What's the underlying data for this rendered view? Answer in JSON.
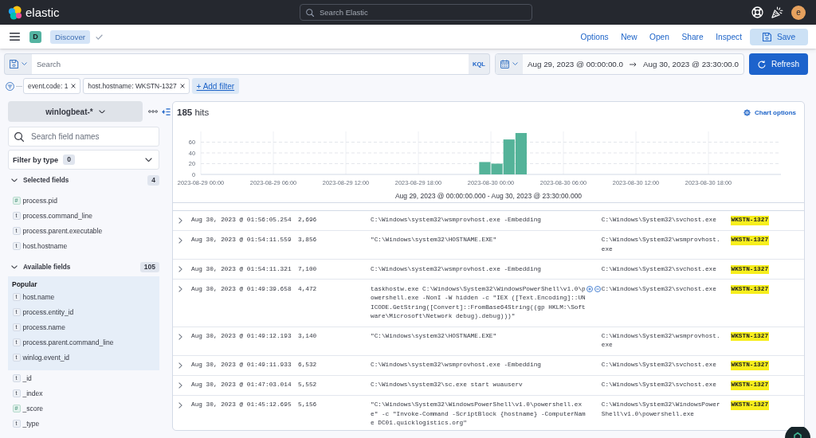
{
  "top_bar": {
    "brand": "elastic",
    "search": {
      "placeholder": "Search Elastic"
    },
    "user_initial": "e"
  },
  "header": {
    "space_initial": "D",
    "breadcrumb": "Discover",
    "links": [
      "Options",
      "New",
      "Open",
      "Share",
      "Inspect"
    ],
    "save_button": "Save"
  },
  "query_bar": {
    "search": {
      "placeholder": "Search"
    },
    "language": "KQL",
    "start_date": "Aug 29, 2023 @ 00:00:00.0",
    "end_date": "Aug 30, 2023 @ 23:30:00.0",
    "refresh_button": "Refresh"
  },
  "filter_bar": {
    "filters": [
      "event.code: 1",
      "host.hostname: WKSTN-1327"
    ],
    "add_filter": "+ Add filter"
  },
  "sidebar": {
    "index_pattern": "winlogbeat-*",
    "field_search": {
      "placeholder": "Search field names"
    },
    "filter_by_type": {
      "label": "Filter by type",
      "count": "0"
    },
    "sections": [
      {
        "title": "Selected fields",
        "count": "4",
        "expanded": true,
        "groups": [
          {
            "fields": [
              {
                "name": "process.pid",
                "kind": "number",
                "token": "#"
              },
              {
                "name": "process.command_line",
                "kind": "string",
                "token": "t"
              },
              {
                "name": "process.parent.executable",
                "kind": "string",
                "token": "t"
              },
              {
                "name": "host.hostname",
                "kind": "string",
                "token": "t"
              }
            ]
          }
        ]
      },
      {
        "title": "Available fields",
        "count": "105",
        "expanded": true,
        "groups": [
          {
            "title": "Popular",
            "fields": [
              {
                "name": "host.name",
                "kind": "string",
                "token": "t"
              },
              {
                "name": "process.entity_id",
                "kind": "string",
                "token": "t"
              },
              {
                "name": "process.name",
                "kind": "string",
                "token": "t"
              },
              {
                "name": "process.parent.command_line",
                "kind": "string",
                "token": "t"
              },
              {
                "name": "winlog.event_id",
                "kind": "string",
                "token": "t"
              }
            ]
          },
          {
            "fields": [
              {
                "name": "_id",
                "kind": "string",
                "token": "t"
              },
              {
                "name": "_index",
                "kind": "string",
                "token": "t"
              },
              {
                "name": "_score",
                "kind": "number",
                "token": "#"
              },
              {
                "name": "_type",
                "kind": "string",
                "token": "t"
              }
            ]
          }
        ]
      }
    ]
  },
  "results": {
    "hits": "**185** hits",
    "chart_options": "Chart options",
    "chart_data": {
      "type": "bar",
      "xlabel": "Aug 29, 2023 @ 00:00:00.000 - Aug 30, 2023 @ 23:30:00.000",
      "categories": [
        "2023-08-29 00:00",
        null,
        null,
        null,
        null,
        null,
        "2023-08-29 06:00",
        null,
        null,
        null,
        null,
        null,
        "2023-08-29 12:00",
        null,
        null,
        null,
        null,
        null,
        "2023-08-29 18:00",
        null,
        null,
        null,
        null,
        null,
        "2023-08-30 00:00",
        null,
        null,
        null,
        null,
        null,
        "2023-08-30 06:00",
        null,
        null,
        null,
        null,
        null,
        "2023-08-30 12:00",
        null,
        null,
        null,
        null,
        null,
        "2023-08-30 18:00",
        null,
        null,
        null,
        null,
        null
      ],
      "series": [
        {
          "color": "#54b399",
          "values": [
            0,
            0,
            0,
            0,
            0,
            0,
            0,
            0,
            0,
            0,
            0,
            0,
            0,
            0,
            0,
            0,
            0,
            0,
            0,
            0,
            0,
            0,
            0,
            23,
            20,
            65,
            77,
            0,
            0,
            0,
            0,
            0,
            0,
            0,
            0,
            0,
            0,
            0,
            0,
            0,
            0,
            0,
            0,
            0,
            0,
            0,
            0,
            0
          ]
        }
      ],
      "ylim": [
        0,
        80
      ],
      "yticks": [
        0,
        20,
        40,
        60
      ],
      "grid": true
    }
  },
  "table": {
    "rows": [
      {
        "expanded": false,
        "hovered": false,
        "timestamp": "Aug 30, 2023 @ 01:56:05.254",
        "process_pid": "2,696",
        "process_command_line": "C:\\Windows\\system32\\wsmprovhost.exe -Embedding",
        "process_parent_executable": "C:\\Windows\\System32\\svchost.exe",
        "host_hostname": "WKSTN-1327",
        "host_hostname_highlighted": true
      },
      {
        "expanded": false,
        "hovered": false,
        "timestamp": "Aug 30, 2023 @ 01:54:11.559",
        "process_pid": "3,856",
        "process_command_line": "\"C:\\Windows\\system32\\HOSTNAME.EXE\"",
        "process_parent_executable": "C:\\Windows\\System32\\wsmprovhost.exe",
        "host_hostname": "WKSTN-1327",
        "host_hostname_highlighted": true
      },
      {
        "expanded": false,
        "hovered": false,
        "timestamp": "Aug 30, 2023 @ 01:54:11.321",
        "process_pid": "7,100",
        "process_command_line": "C:\\Windows\\system32\\wsmprovhost.exe -Embedding",
        "process_parent_executable": "C:\\Windows\\System32\\svchost.exe",
        "host_hostname": "WKSTN-1327",
        "host_hostname_highlighted": true
      },
      {
        "expanded": false,
        "hovered": true,
        "timestamp": "Aug 30, 2023 @ 01:49:39.658",
        "process_pid": "4,472",
        "process_command_line": "taskhostw.exe C:\\Windows\\System32\\WindowsPowerShell\\v1.0\\powershell.exe -NonI -W hidden -c \"IEX ([Text.Encoding]::UNICODE.GetString([Convert]::FromBase64String((gp HKLM:\\Software\\Microsoft\\Network debug).debug)))\"",
        "process_parent_executable": "C:\\Windows\\System32\\svchost.exe",
        "host_hostname": "WKSTN-1327",
        "host_hostname_highlighted": true
      },
      {
        "expanded": false,
        "hovered": false,
        "timestamp": "Aug 30, 2023 @ 01:49:12.193",
        "process_pid": "3,140",
        "process_command_line": "\"C:\\Windows\\system32\\HOSTNAME.EXE\"",
        "process_parent_executable": "C:\\Windows\\System32\\wsmprovhost.exe",
        "host_hostname": "WKSTN-1327",
        "host_hostname_highlighted": true
      },
      {
        "expanded": false,
        "hovered": false,
        "timestamp": "Aug 30, 2023 @ 01:49:11.933",
        "process_pid": "6,532",
        "process_command_line": "C:\\Windows\\system32\\wsmprovhost.exe -Embedding",
        "process_parent_executable": "C:\\Windows\\System32\\svchost.exe",
        "host_hostname": "WKSTN-1327",
        "host_hostname_highlighted": true
      },
      {
        "expanded": false,
        "hovered": false,
        "timestamp": "Aug 30, 2023 @ 01:47:03.014",
        "process_pid": "5,552",
        "process_command_line": "C:\\Windows\\system32\\sc.exe start wuauserv",
        "process_parent_executable": "C:\\Windows\\System32\\svchost.exe",
        "host_hostname": "WKSTN-1327",
        "host_hostname_highlighted": true
      },
      {
        "expanded": false,
        "hovered": false,
        "timestamp": "Aug 30, 2023 @ 01:45:12.695",
        "process_pid": "5,156",
        "process_command_line": "\"C:\\Windows\\System32\\WindowsPowerShell\\v1.0\\powershell.exe\" -c \"Invoke-Command -ScriptBlock {hostname} -ComputerName DC01.quicklogistics.org\"",
        "process_parent_executable": "C:\\Windows\\System32\\WindowsPowerShell\\v1.0\\powershell.exe",
        "host_hostname": "WKSTN-1327",
        "host_hostname_highlighted": true
      }
    ]
  }
}
